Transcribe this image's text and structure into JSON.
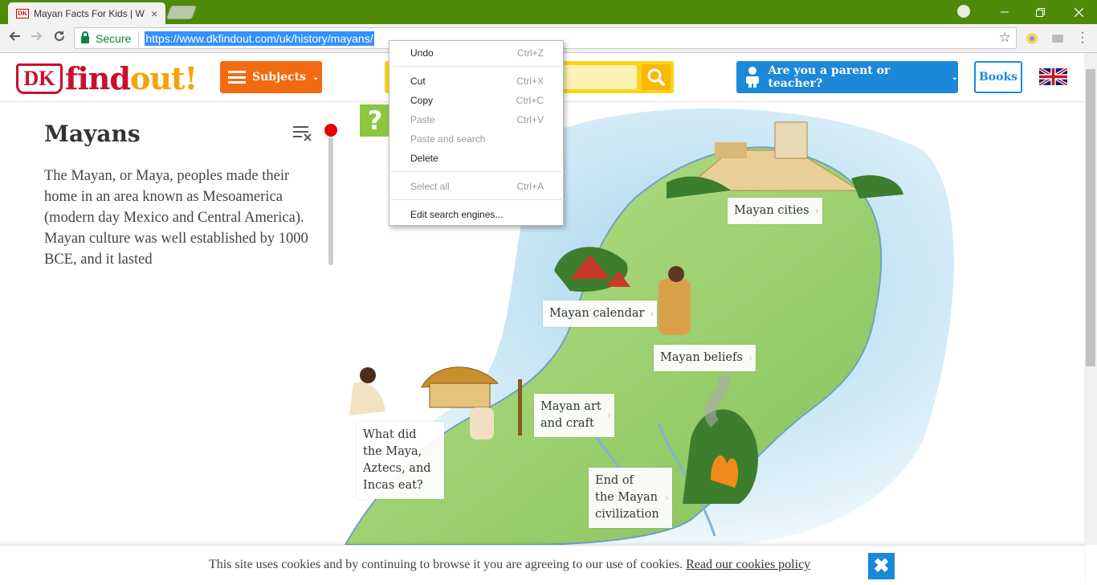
{
  "browser": {
    "tab_title": "Mayan Facts For Kids | W",
    "tab_favicon": "DK",
    "close_glyph": "×",
    "secure_label": "Secure",
    "url": "https://www.dkfindout.com/uk/history/mayans/"
  },
  "header": {
    "logo_dk": "DK",
    "logo_find": "find",
    "logo_out": "out!",
    "subjects_label": "Subjects",
    "parent_label": "Are you a parent or teacher?",
    "books_label": "Books",
    "colors": {
      "subjects": "#f26a12",
      "search": "#fbd41a",
      "parent": "#1c88d8",
      "brand_red": "#c8102e"
    }
  },
  "article": {
    "title": "Mayans",
    "intro": "The Mayan, or Maya, peoples made their home in an area known as Mesoamerica (modern day Mexico and Central America). Mayan culture was well established by 1000 BCE, and it lasted",
    "quiz_label": "?"
  },
  "map_labels": [
    {
      "lines": [
        "Mayan cities"
      ]
    },
    {
      "lines": [
        "Mayan calendar"
      ]
    },
    {
      "lines": [
        "Mayan beliefs"
      ]
    },
    {
      "lines": [
        "Mayan art",
        "and craft"
      ]
    },
    {
      "lines": [
        "What did",
        "the Maya,",
        "Aztecs, and",
        "Incas eat?"
      ]
    },
    {
      "lines": [
        "End of",
        "the Mayan",
        "civilization"
      ]
    }
  ],
  "context_menu": {
    "items": [
      {
        "label": "Undo",
        "shortcut": "Ctrl+Z",
        "enabled": true
      },
      {
        "label": "Cut",
        "shortcut": "Ctrl+X",
        "enabled": true
      },
      {
        "label": "Copy",
        "shortcut": "Ctrl+C",
        "enabled": true
      },
      {
        "label": "Paste",
        "shortcut": "Ctrl+V",
        "enabled": false
      },
      {
        "label": "Paste and search",
        "shortcut": "",
        "enabled": false
      },
      {
        "label": "Delete",
        "shortcut": "",
        "enabled": true
      },
      {
        "label": "Select all",
        "shortcut": "Ctrl+A",
        "enabled": false
      },
      {
        "label": "Edit search engines...",
        "shortcut": "",
        "enabled": true
      }
    ]
  },
  "cookie": {
    "text": "This site uses cookies and by continuing to browse it you are agreeing to our use of cookies.",
    "link": "Read our cookies policy",
    "close_glyph": "✖"
  }
}
